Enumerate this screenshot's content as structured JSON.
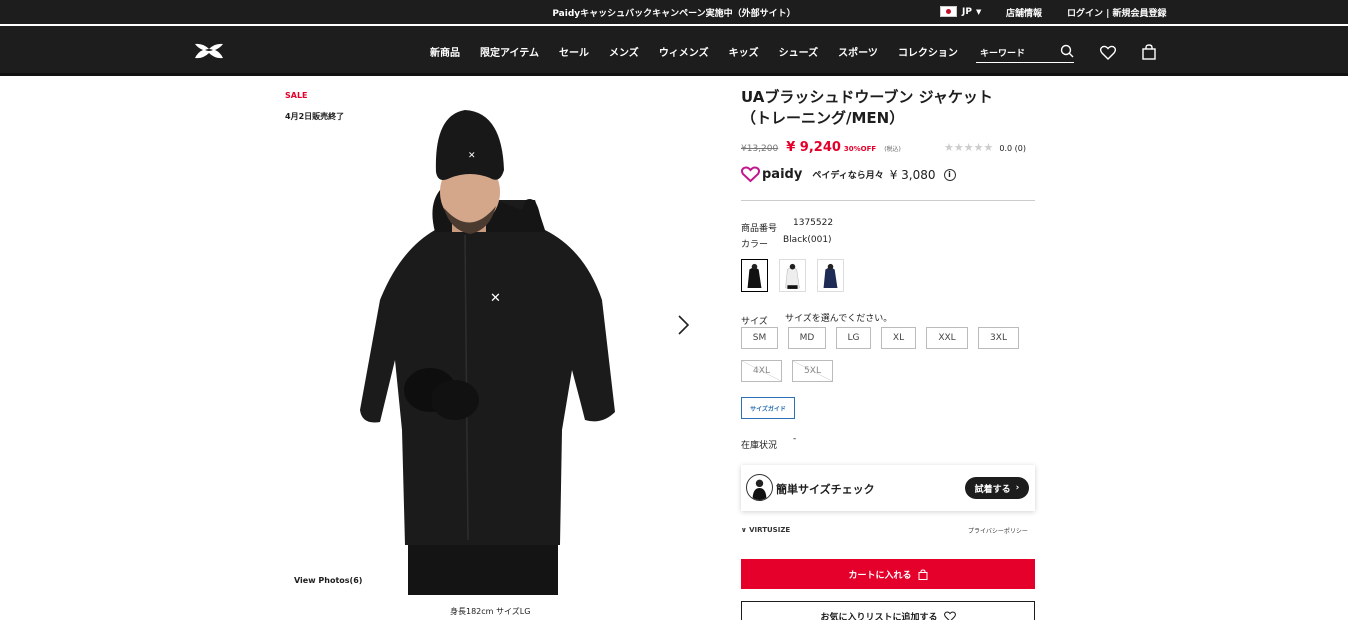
{
  "promo": {
    "message": "Paidyキャッシュバックキャンペーン実施中（外部サイト）",
    "locale": "JP",
    "stores": "店舗情報",
    "login": "ログイン | 新規会員登録"
  },
  "nav": {
    "items": [
      "新商品",
      "限定アイテム",
      "セール",
      "メンズ",
      "ウィメンズ",
      "キッズ",
      "シューズ",
      "スポーツ",
      "コレクション"
    ],
    "search_placeholder": "キーワード"
  },
  "gallery": {
    "sale_label": "SALE",
    "end_date": "4月2日販売終了",
    "view_photos": "View Photos(6)",
    "caption": "身長182cm サイズLG"
  },
  "product": {
    "title_line1": "UAブラッシュドウーブン ジャケット",
    "title_line2": "（トレーニング/MEN）",
    "old_price": "¥13,200",
    "sale_price": "¥ 9,240",
    "discount": "30%OFF",
    "tax_note": "(税込)",
    "rating": "0.0 (0)",
    "rating_stars_filled": 0,
    "paidy_brand": "paidy",
    "paidy_text": "ペイディなら月々",
    "paidy_amount": "¥ 3,080",
    "item_number_label": "商品番号",
    "item_number": "1375522",
    "color_label": "カラー",
    "color_value": "Black(001)",
    "swatches": [
      "black",
      "white",
      "navy"
    ],
    "size_label": "サイズ",
    "size_prompt": "サイズを選んでください。",
    "sizes_row1": [
      "SM",
      "MD",
      "LG",
      "XL",
      "XXL",
      "3XL"
    ],
    "sizes_row2": [
      "4XL",
      "5XL"
    ],
    "size_guide": "サイズガイド",
    "stock_label": "在庫状況",
    "stock_value": "-",
    "virtusize_title": "簡単サイズチェック",
    "virtusize_try": "試着する",
    "virtusize_brand": "VIRTUSIZE",
    "privacy": "プライバシーポリシー",
    "add_to_cart": "カートに入れる",
    "add_to_wishlist": "お気に入りリストに追加する"
  },
  "colors": {
    "accent": "#e4002b",
    "dark": "#1d1d1d",
    "link": "#2b6fb4"
  }
}
